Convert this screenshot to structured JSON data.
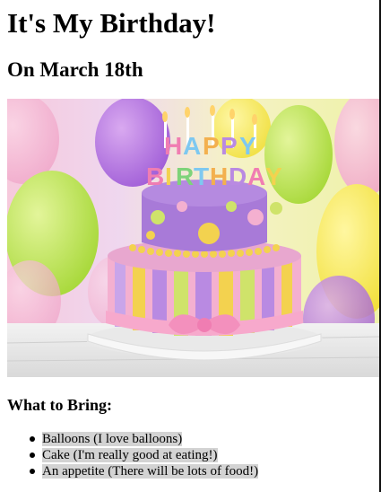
{
  "header": {
    "title": "It's My Birthday!",
    "subtitle": "On March 18th"
  },
  "image": {
    "name": "birthday-cake-photo",
    "depicts": "HAPPY BIRTHDAY"
  },
  "bring": {
    "heading": "What to Bring:",
    "items": [
      "Balloons (I love balloons)",
      "Cake (I'm really good at eating!)",
      "An appetite (There will be lots of food!)"
    ],
    "highlight_color": "#d3d3d3"
  }
}
